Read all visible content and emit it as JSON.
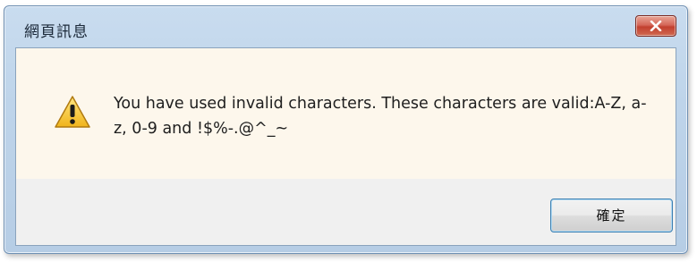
{
  "window": {
    "title": "網頁訊息",
    "close_icon": "close-icon"
  },
  "message": {
    "icon": "warning-icon",
    "text": "You have used invalid characters. These characters are valid:A-Z, a-z, 0-9 and !$%-.@^_~"
  },
  "buttons": {
    "ok_label": "確定"
  },
  "colors": {
    "message_background": "#fdf7ec",
    "close_button": "#c2402f",
    "warning_yellow": "#f2c230"
  }
}
